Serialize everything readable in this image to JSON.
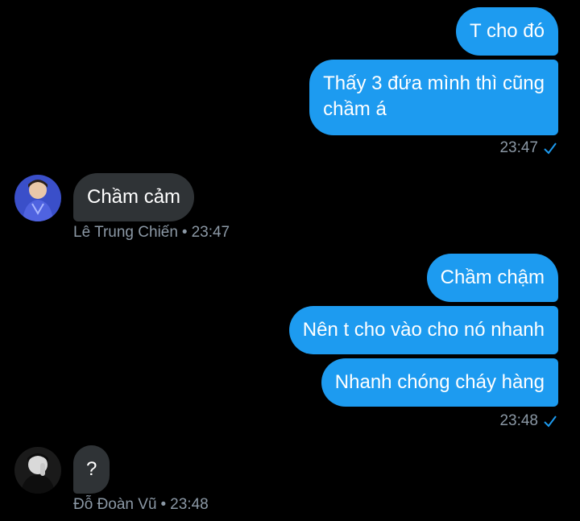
{
  "colors": {
    "background": "#000000",
    "outgoing_bubble": "#1d9bf0",
    "incoming_bubble": "#2f3336",
    "meta_text": "#8b98a5",
    "check": "#1d9bf0"
  },
  "group1": {
    "msg1": "T cho đó",
    "msg2_line1": "Thấy 3 đứa mình thì cũng",
    "msg2_line2": "chầm á",
    "time": "23:47",
    "status_icon": "sent-check-icon"
  },
  "incoming1": {
    "text": "Chầm cảm",
    "sender": "Lê Trung Chiến",
    "separator": "•",
    "time": "23:47",
    "avatar_icon": "avatar"
  },
  "group2": {
    "msg1": "Chầm chậm",
    "msg2": "Nên t cho vào cho nó nhanh",
    "msg3": "Nhanh chóng cháy hàng",
    "time": "23:48",
    "status_icon": "sent-check-icon"
  },
  "incoming2": {
    "text": "?",
    "sender": "Đỗ Đoàn Vũ",
    "separator": "•",
    "time": "23:48",
    "avatar_icon": "avatar"
  }
}
